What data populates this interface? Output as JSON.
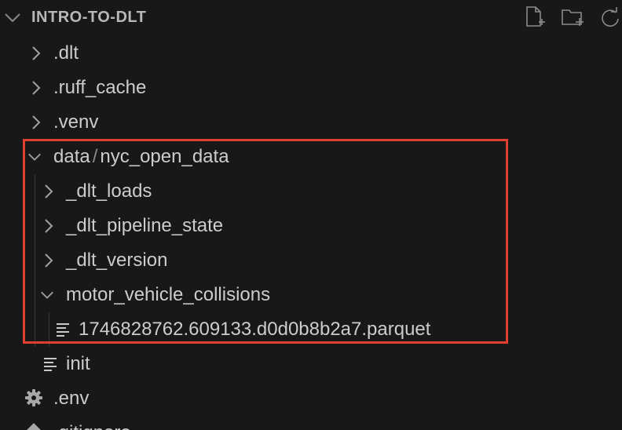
{
  "explorer": {
    "title": "INTRO-TO-DLT",
    "header_actions": [
      {
        "icon": "new-file-icon"
      },
      {
        "icon": "new-folder-icon"
      },
      {
        "icon": "refresh-icon"
      }
    ],
    "items": [
      {
        "label": ".dlt",
        "type": "folder",
        "expanded": false
      },
      {
        "label": ".ruff_cache",
        "type": "folder",
        "expanded": false
      },
      {
        "label": ".venv",
        "type": "folder",
        "expanded": false
      },
      {
        "label_parent": "data",
        "separator": "/",
        "label_child": "nyc_open_data",
        "type": "folder",
        "expanded": true
      },
      {
        "label": "_dlt_loads",
        "type": "folder",
        "expanded": false
      },
      {
        "label": "_dlt_pipeline_state",
        "type": "folder",
        "expanded": false
      },
      {
        "label": "_dlt_version",
        "type": "folder",
        "expanded": false
      },
      {
        "label": "motor_vehicle_collisions",
        "type": "folder",
        "expanded": true
      },
      {
        "label": "1746828762.609133.d0d0b8b2a7.parquet",
        "type": "file",
        "icon": "text-file-icon"
      },
      {
        "label": "init",
        "type": "file",
        "icon": "text-file-icon"
      },
      {
        "label": ".env",
        "type": "file",
        "icon": "gear-icon"
      },
      {
        "label": ".gitignore",
        "type": "file",
        "icon": "git-icon"
      }
    ]
  },
  "colors": {
    "background": "#181818",
    "text": "#cccccc",
    "highlight_border": "#e2402e"
  }
}
